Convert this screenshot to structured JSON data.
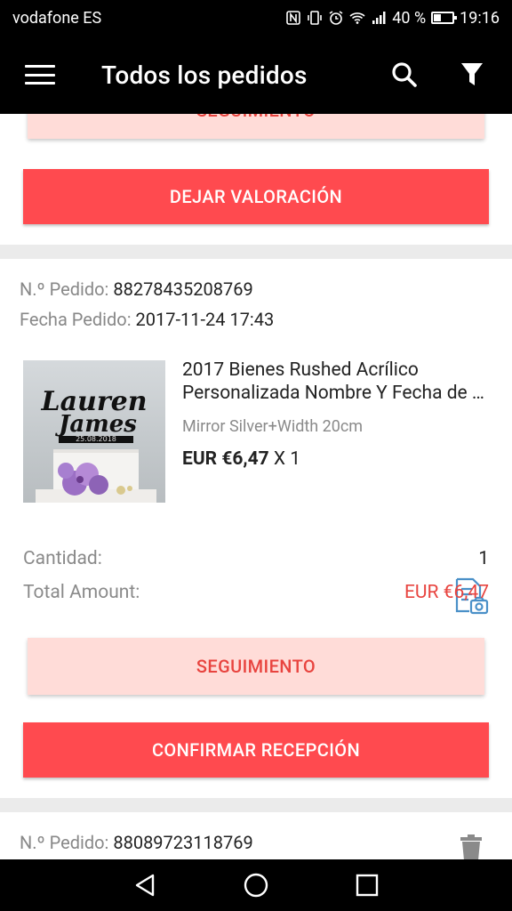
{
  "status_bar": {
    "carrier": "vodafone ES",
    "battery": "40 %",
    "battery_level": 0.4,
    "time": "19:16"
  },
  "header": {
    "title": "Todos los pedidos"
  },
  "top_card": {
    "tracking_label": "SEGUIMIENTO",
    "review_label": "DEJAR VALORACIÓN"
  },
  "order": {
    "number_label": "N.º Pedido:",
    "number": "88278435208769",
    "date_label": "Fecha Pedido:",
    "date": "2017-11-24 17:43",
    "product_title_line1": "2017 Bienes Rushed Acrílico",
    "product_title_line2": "Personalizada Nombre Y Fecha de Boda",
    "variant": "Mirror Silver+Width 20cm",
    "price": "EUR €6,47",
    "multiplier": "X 1",
    "thumb_text_line1": "Lauren",
    "thumb_text_line2": "James",
    "thumb_date": "25.08.2018",
    "quantity_label": "Cantidad:",
    "quantity": "1",
    "total_label": "Total Amount:",
    "total": "EUR €6,47",
    "tracking_label": "SEGUIMIENTO",
    "confirm_label": "CONFIRMAR RECEPCIÓN"
  },
  "next_order": {
    "number_label": "N.º Pedido:",
    "number": "88089723118769"
  },
  "colors": {
    "accent_red": "#ff4a4f",
    "light_pink": "#ffdcd8",
    "price_red": "#e8443f",
    "icon_blue": "#4a90c8"
  }
}
